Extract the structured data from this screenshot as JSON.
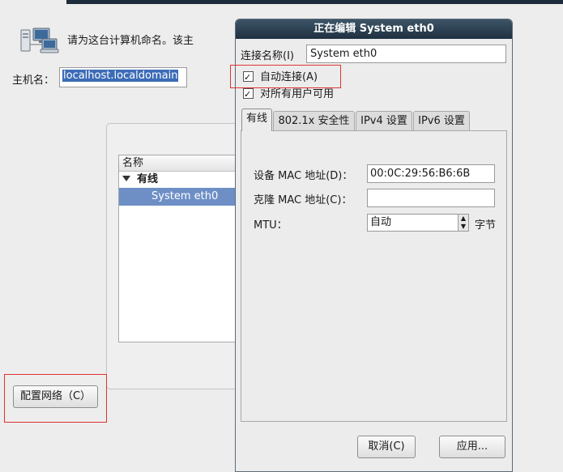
{
  "installer": {
    "prompt": "请为这台计算机命名。该主",
    "hostname_label": "主机名：",
    "hostname_value": "localhost.localdomain",
    "connections_list": {
      "column_header": "名称",
      "group_label": "有线",
      "row_label": "System eth0"
    },
    "configure_network_button": "配置网络（C）"
  },
  "dialog": {
    "title": "正在编辑 System eth0",
    "connection_name_label": "连接名称(I)",
    "connection_name_value": "System eth0",
    "auto_connect_label": "自动连接(A)",
    "auto_connect_checked": true,
    "all_users_label": "对所有用户可用",
    "all_users_checked": true,
    "tabs": [
      "有线",
      "802.1x 安全性",
      "IPv4 设置",
      "IPv6 设置"
    ],
    "active_tab": "有线",
    "wired": {
      "device_mac_label": "设备 MAC 地址(D)：",
      "device_mac_value": "00:0C:29:56:B6:6B",
      "cloned_mac_label": "克隆 MAC 地址(C)：",
      "cloned_mac_value": "",
      "mtu_label": "MTU：",
      "mtu_value": "自动",
      "mtu_unit": "字节"
    },
    "cancel_button": "取消(C)",
    "apply_button": "应用..."
  },
  "colors": {
    "selection": "#6d8fc6",
    "annotation_red": "#e03232",
    "titlebar": "#2c4152"
  },
  "icons": [
    "network-computers-icon",
    "expander-down-icon",
    "checkbox-checked-icon",
    "spin-up-icon",
    "spin-down-icon"
  ]
}
